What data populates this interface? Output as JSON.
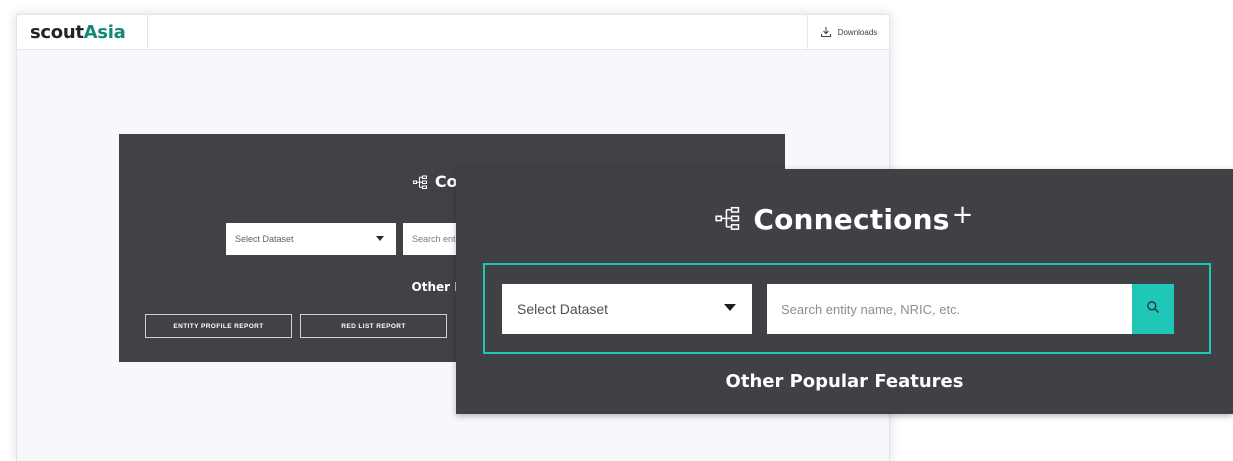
{
  "header": {
    "logo_part1": "scout",
    "logo_part2": "Asia",
    "downloads_label": "Downloads"
  },
  "panel": {
    "title": "Conne",
    "dataset_select": "Select Dataset",
    "search_truncated": "Search ent",
    "popular_truncated": "Other Popul",
    "buttons": [
      {
        "label": "ENTITY PROFILE REPORT"
      },
      {
        "label": "RED LIST REPORT"
      }
    ]
  },
  "zoom": {
    "title": "Connections",
    "title_suffix": "+",
    "dataset_select": "Select Dataset",
    "search_placeholder": "Search entity name, NRIC, etc.",
    "popular_heading": "Other Popular Features"
  },
  "colors": {
    "brand_teal": "#16877c",
    "accent_teal": "#1fc7b8",
    "panel_dark": "#414246"
  },
  "icons": {
    "connections": "connections-hierarchy-icon",
    "downloads": "download-tray-icon",
    "search": "search-icon"
  }
}
